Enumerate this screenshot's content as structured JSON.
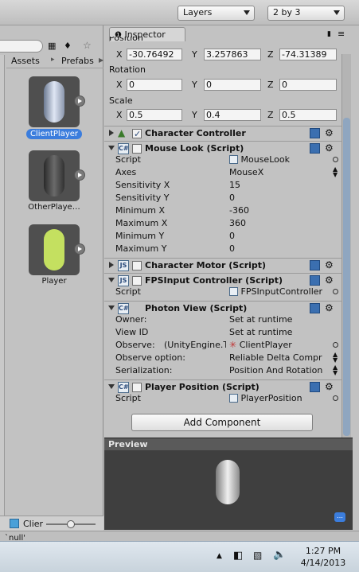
{
  "toolbar": {
    "layers_label": "Layers",
    "layout_label": "2 by 3"
  },
  "project": {
    "breadcrumb_root": "Assets",
    "breadcrumb_sep": "▸",
    "breadcrumb_current": "Prefabs",
    "assets": [
      {
        "label": "ClientPlayer",
        "selected": true
      },
      {
        "label": "OtherPlaye…",
        "selected": false
      },
      {
        "label": "Player",
        "selected": false
      }
    ],
    "footer_label": "Clier"
  },
  "inspector": {
    "tab_label": "Inspector",
    "position_label": "Position",
    "position": {
      "x": "-30.76492",
      "y": "3.257863",
      "z": "-74.31389"
    },
    "rotation_label": "Rotation",
    "rotation": {
      "x": "0",
      "y": "0",
      "z": "0"
    },
    "scale_label": "Scale",
    "scale": {
      "x": "0.5",
      "y": "0.4",
      "z": "0.5"
    },
    "axis_x": "X",
    "axis_y": "Y",
    "axis_z": "Z",
    "character_controller": "Character Controller",
    "mouse_look": {
      "title": "Mouse Look (Script)",
      "script_label": "Script",
      "script_value": "MouseLook",
      "axes_label": "Axes",
      "axes_value": "MouseX",
      "sens_x_label": "Sensitivity X",
      "sens_x": "15",
      "sens_y_label": "Sensitivity Y",
      "sens_y": "0",
      "min_x_label": "Minimum X",
      "min_x": "-360",
      "max_x_label": "Maximum X",
      "max_x": "360",
      "min_y_label": "Minimum Y",
      "min_y": "0",
      "max_y_label": "Maximum Y",
      "max_y": "0"
    },
    "character_motor": "Character Motor (Script)",
    "fps_input": {
      "title": "FPSInput Controller (Script)",
      "script_label": "Script",
      "script_value": "FPSInputController"
    },
    "photon_view": {
      "title": "Photon View (Script)",
      "owner_label": "Owner:",
      "owner_value": "Set at runtime",
      "viewid_label": "View ID",
      "viewid_value": "Set at runtime",
      "observe_label": "Observe:",
      "observe_type": "(UnityEngine.T",
      "observe_value": "ClientPlayer",
      "observe_option_label": "Observe option:",
      "observe_option_value": "Reliable Delta Compr",
      "serialization_label": "Serialization:",
      "serialization_value": "Position And Rotation"
    },
    "player_position": {
      "title": "Player Position (Script)",
      "script_label": "Script",
      "script_value": "PlayerPosition"
    },
    "add_component": "Add Component"
  },
  "preview": {
    "label": "Preview"
  },
  "console": {
    "text": "`null'"
  },
  "taskbar": {
    "time": "1:27 PM",
    "date": "4/14/2013"
  },
  "colors": {
    "selection": "#3b7ddd",
    "player_capsule": "#c4e060"
  }
}
